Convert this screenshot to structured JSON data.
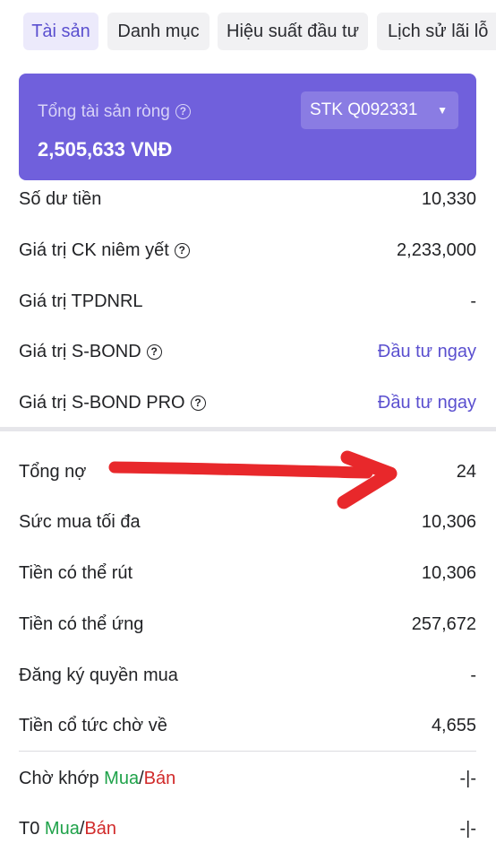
{
  "tabs": [
    {
      "label": "Tài sản",
      "active": true
    },
    {
      "label": "Danh mục",
      "active": false
    },
    {
      "label": "Hiệu suất đầu tư",
      "active": false
    },
    {
      "label": "Lịch sử lãi lỗ",
      "active": false
    }
  ],
  "summary": {
    "label": "Tổng tài sản ròng",
    "value": "2,505,633 VNĐ",
    "account": "STK Q092331",
    "help_icon": "question-circle-icon",
    "caret_icon": "caret-down-icon"
  },
  "rows": {
    "cash_balance": {
      "label": "Số dư tiền",
      "value": "10,330"
    },
    "listed_securities": {
      "label": "Giá trị CK niêm yết",
      "value": "2,233,000"
    },
    "tpdnrl": {
      "label": "Giá trị TPDNRL",
      "value": "-"
    },
    "sbond": {
      "label": "Giá trị S-BOND",
      "value": "Đầu tư ngay"
    },
    "sbond_pro": {
      "label": "Giá trị S-BOND PRO",
      "value": "Đầu tư ngay"
    },
    "total_debt": {
      "label": "Tổng nợ",
      "value": "24"
    },
    "max_buying_power": {
      "label": "Sức mua tối đa",
      "value": "10,306"
    },
    "withdrawable": {
      "label": "Tiền có thể rút",
      "value": "10,306"
    },
    "advance_available": {
      "label": "Tiền có thể ứng",
      "value": "257,672"
    },
    "rights_registration": {
      "label": "Đăng ký quyền mua",
      "value": "-"
    },
    "pending_dividend": {
      "label": "Tiền cổ tức chờ về",
      "value": "4,655"
    },
    "pending_match": {
      "label_prefix": "Chờ khớp ",
      "buy": "Mua",
      "slash": "/",
      "sell": "Bán",
      "value": "-|-"
    },
    "t0": {
      "label_prefix": "T0 ",
      "buy": "Mua",
      "slash": "/",
      "sell": "Bán",
      "value": "-|-"
    }
  },
  "colors": {
    "accent": "#7060dc",
    "link": "#5a4fcf",
    "buy": "#1fa24a",
    "sell": "#d12a2a",
    "annotation_arrow": "#e8282b"
  }
}
